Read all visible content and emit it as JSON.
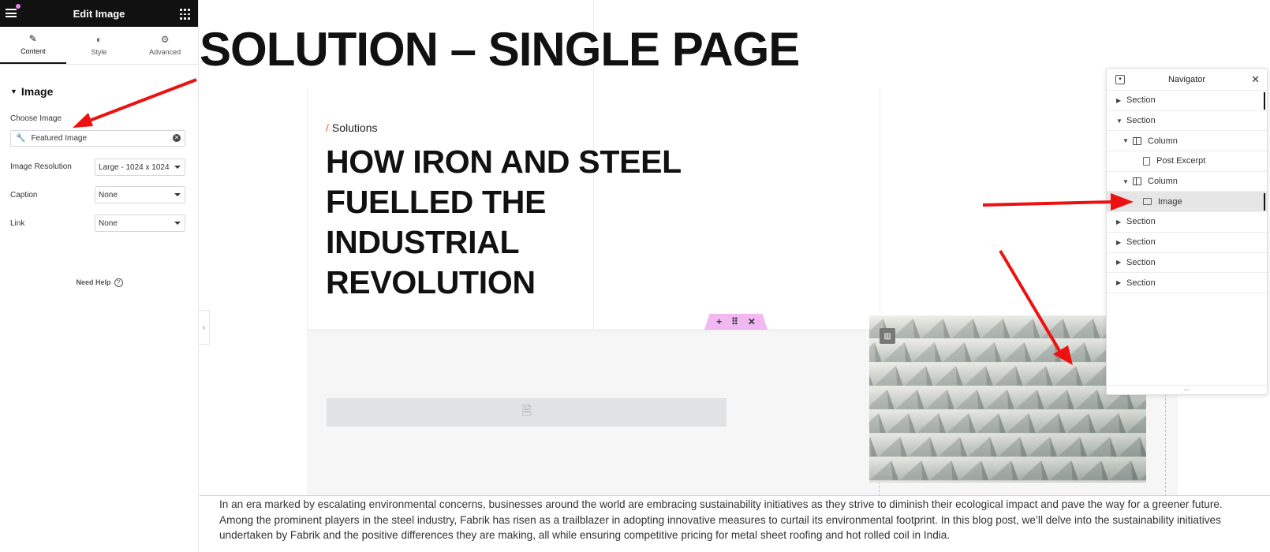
{
  "panel": {
    "title": "Edit Image",
    "tabs": [
      {
        "label": "Content",
        "icon": "pencil-icon"
      },
      {
        "label": "Style",
        "icon": "half-circle-icon"
      },
      {
        "label": "Advanced",
        "icon": "gear-icon"
      }
    ],
    "section_title": "Image",
    "choose_image_label": "Choose Image",
    "choose_image_value": "Featured Image",
    "resolution_label": "Image Resolution",
    "resolution_value": "Large - 1024 x 1024",
    "caption_label": "Caption",
    "caption_value": "None",
    "link_label": "Link",
    "link_value": "None",
    "help_label": "Need Help"
  },
  "canvas": {
    "page_heading": "SOLUTION – SINGLE PAGE",
    "breadcrumb_slash": "/",
    "breadcrumb_label": "Solutions",
    "post_title": "HOW IRON AND STEEL FUELLED THE INDUSTRIAL REVOLUTION",
    "section_handle": {
      "add": "+",
      "move": "⠿",
      "close": "✕"
    },
    "body_text": "In an era marked by escalating environmental concerns, businesses around the world are embracing sustainability initiatives as they strive to diminish their ecological impact and pave the way for a greener future. Among the prominent players in the steel industry, Fabrik has risen as a trailblazer in adopting innovative measures to curtail its environmental footprint. In this blog post, we’ll delve into the sustainability initiatives undertaken by Fabrik and the positive differences they are making, all while ensuring competitive pricing for metal sheet roofing and hot rolled coil in India."
  },
  "navigator": {
    "title": "Navigator",
    "items": [
      {
        "label": "Section",
        "expanded": false
      },
      {
        "label": "Section",
        "expanded": true
      },
      {
        "label": "Column",
        "expanded": true
      },
      {
        "label": "Post Excerpt"
      },
      {
        "label": "Column",
        "expanded": true
      },
      {
        "label": "Image",
        "selected": true
      },
      {
        "label": "Section",
        "expanded": false
      },
      {
        "label": "Section",
        "expanded": false
      },
      {
        "label": "Section",
        "expanded": false
      },
      {
        "label": "Section",
        "expanded": false
      }
    ],
    "footer": "..."
  },
  "colors": {
    "accent_pink": "#f2b8f2",
    "arrow_red": "#ee1111",
    "breadcrumb_accent": "#ff5a1f",
    "header_dark": "#111111"
  }
}
